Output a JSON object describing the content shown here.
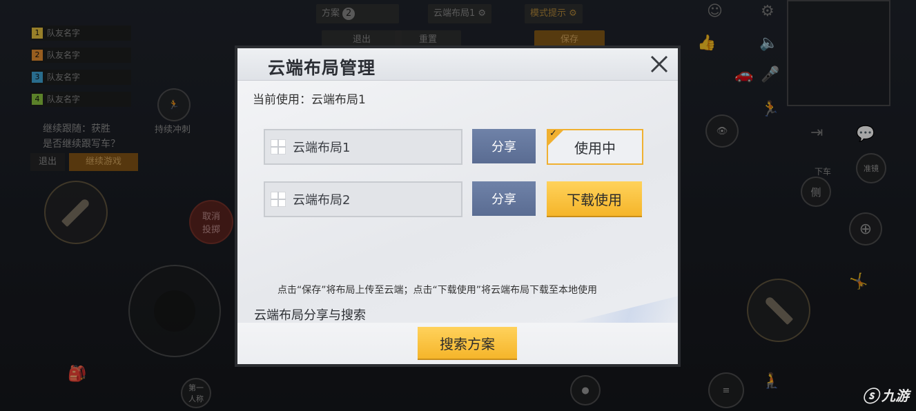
{
  "hud": {
    "team": [
      {
        "num": "1",
        "name": "队友名字",
        "color": "#e8c440"
      },
      {
        "num": "2",
        "name": "队友名字",
        "color": "#e89030"
      },
      {
        "num": "3",
        "name": "队友名字",
        "color": "#3fa6d8"
      },
      {
        "num": "4",
        "name": "队友名字",
        "color": "#8dc63f"
      }
    ],
    "sprint_label": "持续冲刺",
    "follow_line1": "继续跟随：获胜",
    "follow_line2": "是否继续跟写车？",
    "exit_label": "退出",
    "continue_label": "继续游戏",
    "cancel_throw_1": "取消",
    "cancel_throw_2": "投掷",
    "first_person_1": "第一",
    "first_person_2": "人称",
    "top_scheme_label": "2",
    "top_exit": "退出",
    "top_reset": "重置",
    "top_cloud": "云端布局1",
    "top_mode": "模式提示",
    "top_save": "保存",
    "exit_car": "下车",
    "lean_label": "侧",
    "aim_label": "准镜"
  },
  "dialog": {
    "title": "云端布局管理",
    "current_label": "当前使用：云端布局1",
    "layouts": [
      {
        "name": "云端布局1",
        "share": "分享",
        "action": "使用中",
        "in_use": true
      },
      {
        "name": "云端布局2",
        "share": "分享",
        "action": "下载使用",
        "in_use": false
      }
    ],
    "hint": "点击“保存”将布局上传至云端；点击“下载使用”将云端布局下载至本地使用",
    "section_label": "云端布局分享与搜索",
    "search_button": "搜索方案"
  },
  "watermark": "九游",
  "colors": {
    "accent_yellow": "#f5b52a",
    "share_blue": "#5a6c92",
    "in_use_border": "#f0b030"
  }
}
